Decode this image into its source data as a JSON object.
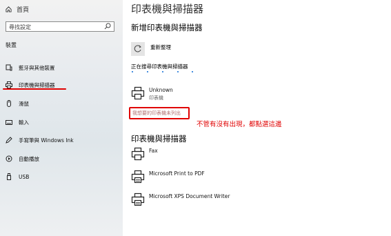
{
  "sidebar": {
    "home_label": "首頁",
    "search_placeholder": "尋找設定",
    "section_title": "裝置",
    "items": [
      {
        "label": "藍牙與其他裝置",
        "icon": "bluetooth-icon"
      },
      {
        "label": "印表機與掃描器",
        "icon": "printer-icon"
      },
      {
        "label": "滑鼠",
        "icon": "mouse-icon"
      },
      {
        "label": "輸入",
        "icon": "keyboard-icon"
      },
      {
        "label": "手寫筆與 Windows Ink",
        "icon": "pen-icon"
      },
      {
        "label": "自動播放",
        "icon": "autoplay-icon"
      },
      {
        "label": "USB",
        "icon": "usb-icon"
      }
    ]
  },
  "main": {
    "title": "印表機與掃描器",
    "add_heading": "新增印表機與掃描器",
    "refresh_label": "重新整理",
    "searching_text": "正在搜尋印表機與掃描器",
    "found_device": {
      "name": "Unknown",
      "type": "印表機"
    },
    "not_listed_link": "我想要的印表機未列出",
    "annotation": "不管有沒有出現，都點選這邊",
    "list_heading": "印表機與掃描器",
    "printers": [
      {
        "name": "Fax",
        "icon": "fax-icon"
      },
      {
        "name": "Microsoft Print to PDF",
        "icon": "printer-icon"
      },
      {
        "name": "Microsoft XPS Document Writer",
        "icon": "printer-icon"
      }
    ]
  },
  "colors": {
    "accent": "#0a6ad6",
    "highlight": "#e00000"
  }
}
